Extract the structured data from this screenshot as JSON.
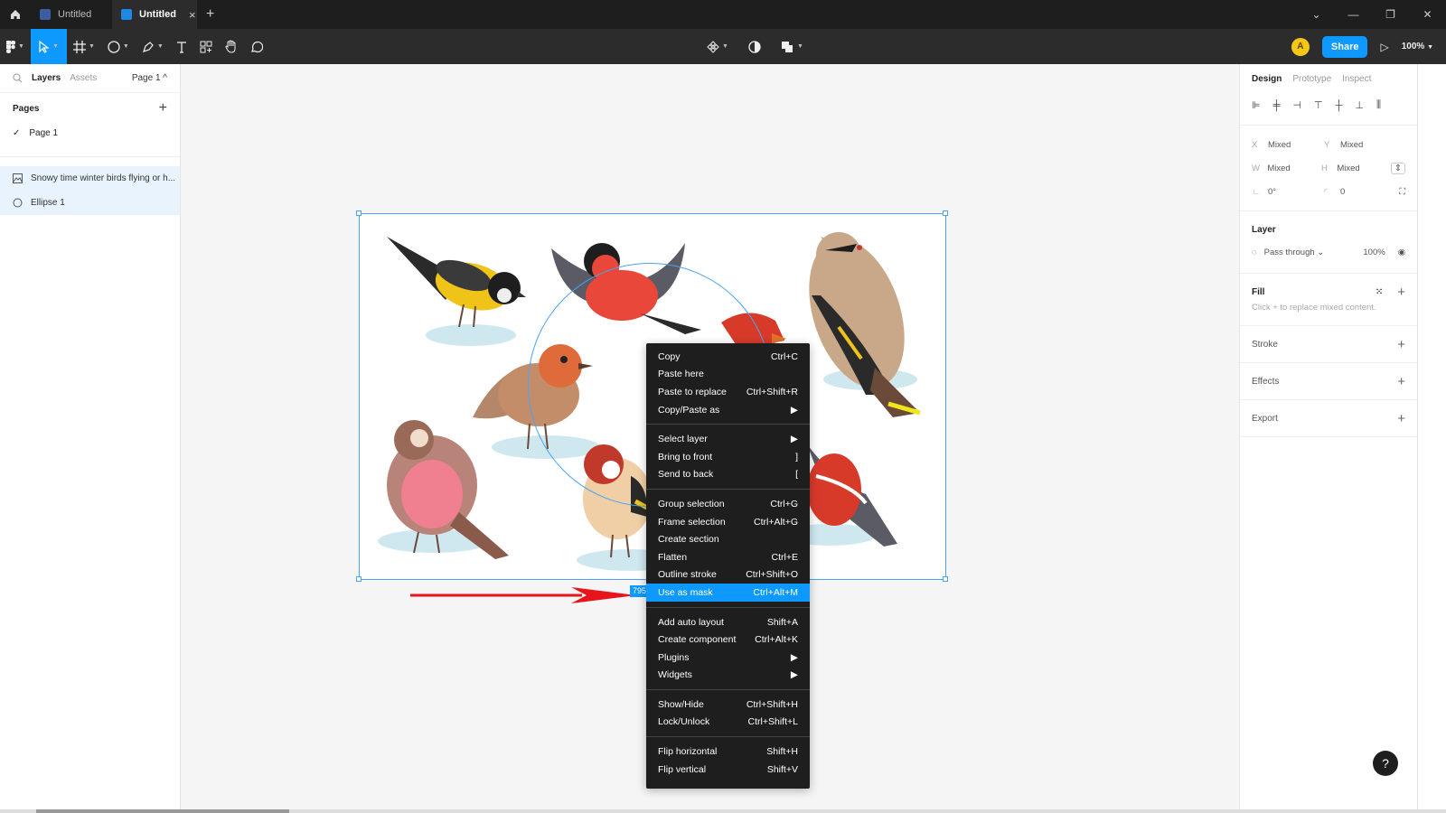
{
  "titlebar": {
    "tabs": [
      {
        "label": "Untitled"
      },
      {
        "label": "Untitled",
        "close": "×"
      }
    ],
    "add": "+",
    "window_controls": [
      "⌄",
      "—",
      "❐",
      "✕"
    ]
  },
  "toolbar": {
    "share_label": "Share",
    "avatar_initial": "A",
    "zoom": "100%"
  },
  "left_panel": {
    "tabs": [
      "Layers",
      "Assets"
    ],
    "page_selector": "Page 1 ^",
    "pages_heading": "Pages",
    "pages": [
      "Page 1"
    ],
    "layers": [
      {
        "label": "Snowy time winter birds flying or h...",
        "icon": "image-icon"
      },
      {
        "label": "Ellipse 1",
        "icon": "ellipse-icon"
      }
    ]
  },
  "canvas": {
    "size_badge": "795"
  },
  "context_menu": {
    "groups": [
      [
        {
          "label": "Copy",
          "shortcut": "Ctrl+C"
        },
        {
          "label": "Paste here",
          "shortcut": ""
        },
        {
          "label": "Paste to replace",
          "shortcut": "Ctrl+Shift+R"
        },
        {
          "label": "Copy/Paste as",
          "shortcut": "▶"
        }
      ],
      [
        {
          "label": "Select layer",
          "shortcut": "▶"
        },
        {
          "label": "Bring to front",
          "shortcut": "]"
        },
        {
          "label": "Send to back",
          "shortcut": "["
        }
      ],
      [
        {
          "label": "Group selection",
          "shortcut": "Ctrl+G"
        },
        {
          "label": "Frame selection",
          "shortcut": "Ctrl+Alt+G"
        },
        {
          "label": "Create section",
          "shortcut": ""
        },
        {
          "label": "Flatten",
          "shortcut": "Ctrl+E"
        },
        {
          "label": "Outline stroke",
          "shortcut": "Ctrl+Shift+O"
        },
        {
          "label": "Use as mask",
          "shortcut": "Ctrl+Alt+M",
          "highlighted": true
        }
      ],
      [
        {
          "label": "Add auto layout",
          "shortcut": "Shift+A"
        },
        {
          "label": "Create component",
          "shortcut": "Ctrl+Alt+K"
        },
        {
          "label": "Plugins",
          "shortcut": "▶"
        },
        {
          "label": "Widgets",
          "shortcut": "▶"
        }
      ],
      [
        {
          "label": "Show/Hide",
          "shortcut": "Ctrl+Shift+H"
        },
        {
          "label": "Lock/Unlock",
          "shortcut": "Ctrl+Shift+L"
        }
      ],
      [
        {
          "label": "Flip horizontal",
          "shortcut": "Shift+H"
        },
        {
          "label": "Flip vertical",
          "shortcut": "Shift+V"
        }
      ]
    ]
  },
  "right_panel": {
    "tabs": [
      "Design",
      "Prototype",
      "Inspect"
    ],
    "props": {
      "x_label": "X",
      "x_value": "Mixed",
      "y_label": "Y",
      "y_value": "Mixed",
      "w_label": "W",
      "w_value": "Mixed",
      "h_label": "H",
      "h_value": "Mixed",
      "rotation": "0°",
      "radius": "0"
    },
    "layer_heading": "Layer",
    "blend_mode": "Pass through ⌄",
    "opacity": "100%",
    "fill_heading": "Fill",
    "fill_hint": "Click + to replace mixed content.",
    "stroke_heading": "Stroke",
    "effects_heading": "Effects",
    "export_heading": "Export"
  },
  "help_label": "?",
  "colors": {
    "accent": "#0d99ff",
    "arrow": "#e8141c",
    "selection": "#4aa3f5"
  }
}
